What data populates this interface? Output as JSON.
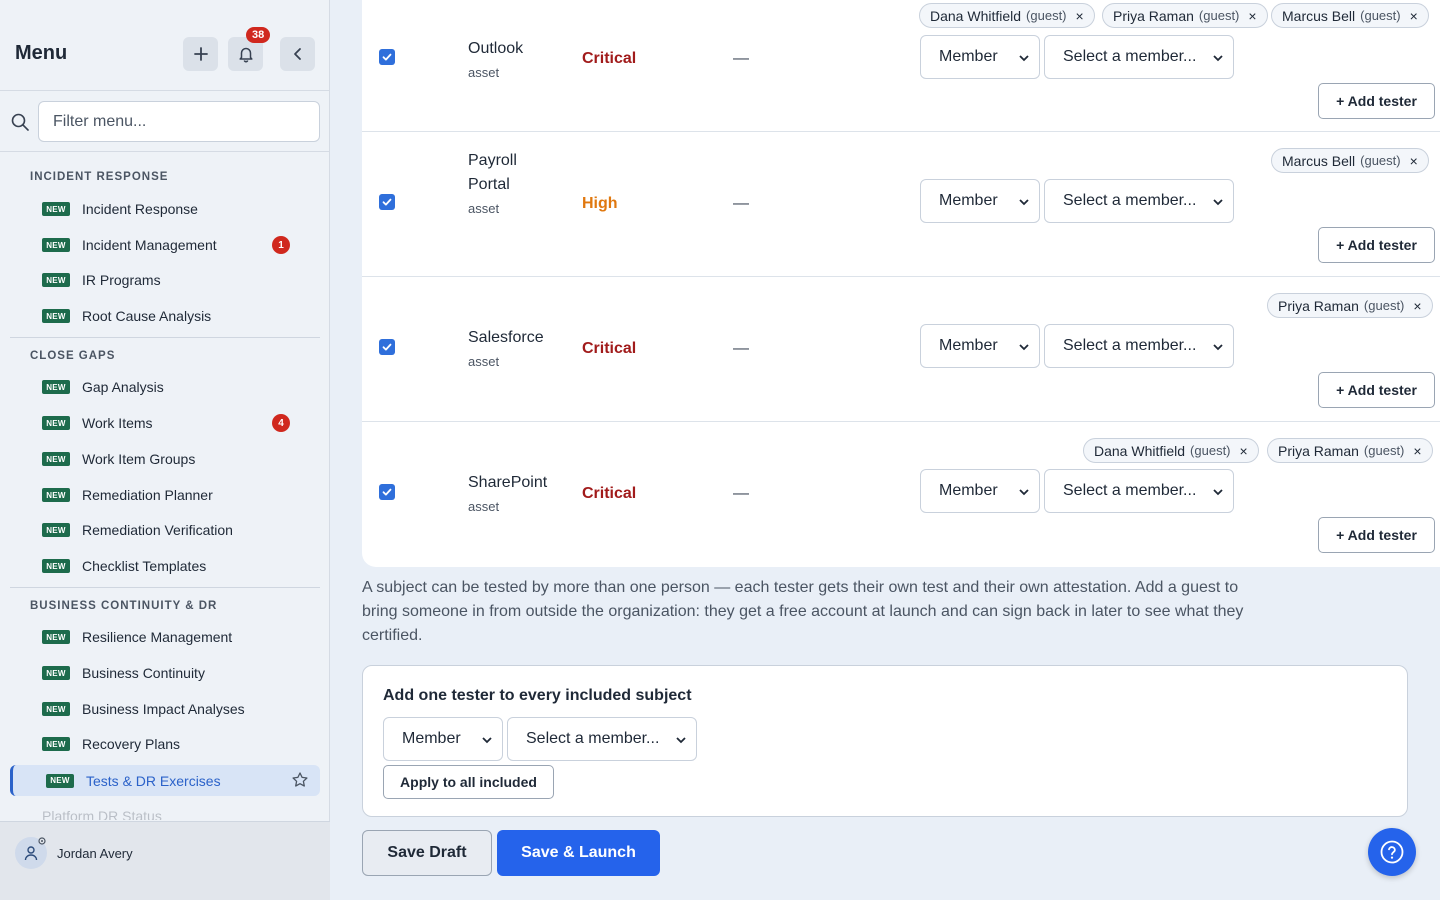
{
  "sidebar": {
    "title": "Menu",
    "notification_count": "38",
    "filter_placeholder": "Filter menu...",
    "new_tag": "NEW",
    "sections": [
      {
        "heading": "INCIDENT RESPONSE",
        "items": [
          {
            "label": "Incident Response"
          },
          {
            "label": "Incident Management",
            "count": "1"
          },
          {
            "label": "IR Programs"
          },
          {
            "label": "Root Cause Analysis"
          }
        ]
      },
      {
        "heading": "CLOSE GAPS",
        "items": [
          {
            "label": "Gap Analysis"
          },
          {
            "label": "Work Items",
            "count": "4"
          },
          {
            "label": "Work Item Groups"
          },
          {
            "label": "Remediation Planner"
          },
          {
            "label": "Remediation Verification"
          },
          {
            "label": "Checklist Templates"
          }
        ]
      },
      {
        "heading": "BUSINESS CONTINUITY & DR",
        "items": [
          {
            "label": "Resilience Management"
          },
          {
            "label": "Business Continuity"
          },
          {
            "label": "Business Impact Analyses"
          },
          {
            "label": "Recovery Plans"
          },
          {
            "label": "Tests & DR Exercises"
          },
          {
            "label": "Platform DR Status"
          }
        ]
      }
    ],
    "user": {
      "name": "Jordan Avery"
    }
  },
  "rows": [
    {
      "name": "Outlook",
      "type": "asset",
      "severity": "Critical",
      "severity_color": "#a11b1b",
      "dash": "—",
      "role": "Member",
      "member_placeholder": "Select a member...",
      "add_label": "+ Add tester",
      "testers": [
        {
          "name": "Dana Whitfield",
          "tag": "(guest)"
        },
        {
          "name": "Priya Raman",
          "tag": "(guest)"
        },
        {
          "name": "Marcus Bell",
          "tag": "(guest)"
        }
      ]
    },
    {
      "name": "Payroll Portal",
      "type": "asset",
      "severity": "High",
      "severity_color": "#e0780f",
      "dash": "—",
      "role": "Member",
      "member_placeholder": "Select a member...",
      "add_label": "+ Add tester",
      "testers": [
        {
          "name": "Marcus Bell",
          "tag": "(guest)"
        }
      ]
    },
    {
      "name": "Salesforce",
      "type": "asset",
      "severity": "Critical",
      "severity_color": "#a11b1b",
      "dash": "—",
      "role": "Member",
      "member_placeholder": "Select a member...",
      "add_label": "+ Add tester",
      "testers": [
        {
          "name": "Priya Raman",
          "tag": "(guest)"
        }
      ]
    },
    {
      "name": "SharePoint",
      "type": "asset",
      "severity": "Critical",
      "severity_color": "#a11b1b",
      "dash": "—",
      "role": "Member",
      "member_placeholder": "Select a member...",
      "add_label": "+ Add tester",
      "testers": [
        {
          "name": "Dana Whitfield",
          "tag": "(guest)"
        },
        {
          "name": "Priya Raman",
          "tag": "(guest)"
        }
      ]
    }
  ],
  "help_text": "A subject can be tested by more than one person — each tester gets their own test and their own attestation. Add a guest to bring someone in from outside the organization: they get a free account at launch and can sign back in later to see what they certified.",
  "bulk": {
    "title": "Add one tester to every included subject",
    "role": "Member",
    "member_placeholder": "Select a member...",
    "apply_label": "Apply to all included"
  },
  "actions": {
    "save_draft": "Save Draft",
    "save_launch": "Save & Launch"
  }
}
